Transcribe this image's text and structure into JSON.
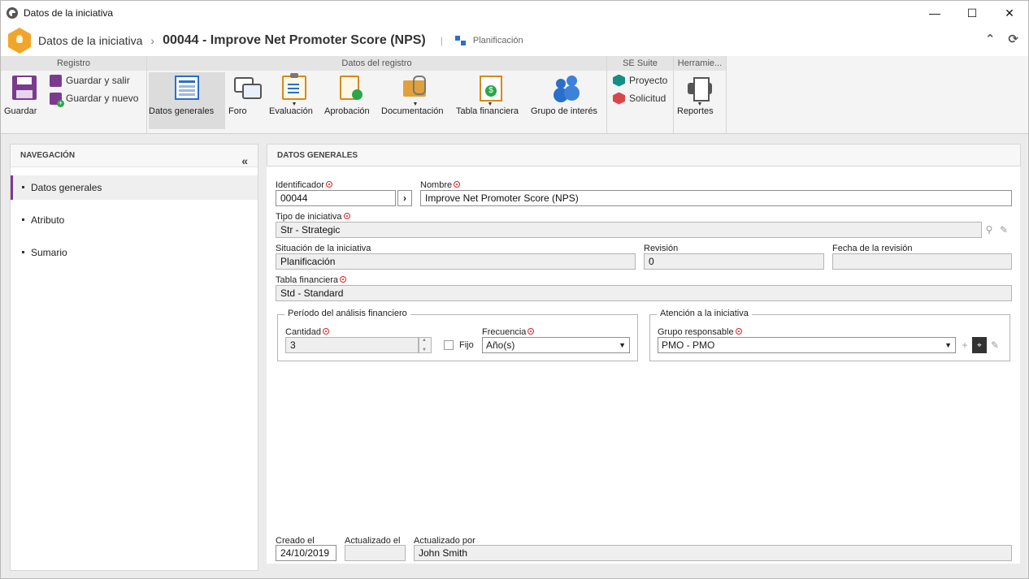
{
  "window": {
    "title": "Datos de la iniciativa",
    "minimize": "—",
    "maximize": "☐",
    "close": "✕"
  },
  "header": {
    "breadcrumb_root": "Datos de la iniciativa",
    "separator": "›",
    "record_title": "00044 - Improve Net Promoter Score (NPS)",
    "divider": "|",
    "status": "Planificación",
    "collapse_glyph": "⌃",
    "refresh_glyph": "⟳"
  },
  "ribbon": {
    "groups": {
      "registro": "Registro",
      "datos_registro": "Datos del registro",
      "se_suite": "SE Suite",
      "herramientas": "Herramie..."
    },
    "save": "Guardar",
    "save_exit": "Guardar y salir",
    "save_new": "Guardar y nuevo",
    "general": "Datos generales",
    "forum": "Foro",
    "evaluation": "Evaluación",
    "approval": "Aprobación",
    "documentation": "Documentación",
    "financial": "Tabla financiera",
    "interest": "Grupo de interés",
    "project": "Proyecto",
    "request": "Solicitud",
    "reports": "Reportes",
    "caret": "▼"
  },
  "navigation": {
    "title": "NAVEGACIÓN",
    "collapse": "«",
    "items": [
      "Datos generales",
      "Atributo",
      "Sumario"
    ]
  },
  "form": {
    "title": "DATOS GENERALES",
    "identifier_label": "Identificador",
    "identifier_value": "00044",
    "arrow": "›",
    "name_label": "Nombre",
    "name_value": "Improve Net Promoter Score (NPS)",
    "type_label": "Tipo de iniciativa",
    "type_value": "Str - Strategic",
    "situation_label": "Situación de la iniciativa",
    "situation_value": "Planificación",
    "revision_label": "Revisión",
    "revision_value": "0",
    "revision_date_label": "Fecha de la revisión",
    "revision_date_value": "",
    "fin_table_label": "Tabla financiera",
    "fin_table_value": "Std - Standard",
    "period_legend": "Período del análisis financiero",
    "quantity_label": "Cantidad",
    "quantity_value": "3",
    "fixed_label": "Fijo",
    "frequency_label": "Frecuencia",
    "frequency_value": "Año(s)",
    "attention_legend": "Atención a la iniciativa",
    "group_label": "Grupo responsable",
    "group_value": "PMO - PMO",
    "created_label": "Creado el",
    "created_value": "24/10/2019",
    "updated_label": "Actualizado el",
    "updated_value": "",
    "updated_by_label": "Actualizado por",
    "updated_by_value": "John Smith",
    "search_glyph": "⚲",
    "clear_glyph": "✎",
    "add_glyph": "+",
    "binoculars_glyph": "⌖"
  }
}
